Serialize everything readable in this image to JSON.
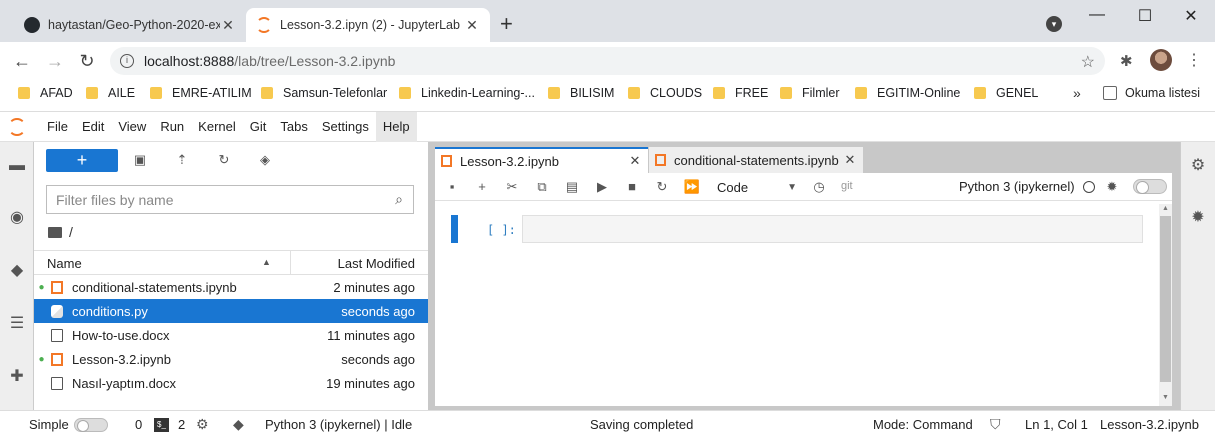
{
  "browser": {
    "tabs": [
      {
        "title": "haytastan/Geo-Python-2020-exe",
        "close": "✕"
      },
      {
        "title": "Lesson-3.2.ipyn (2) - JupyterLab",
        "close": "✕"
      }
    ],
    "new_tab": "+",
    "window_controls": {
      "minimize": "—",
      "maximize": "☐",
      "close": "✕"
    },
    "url_host": "localhost:8888",
    "url_path": "/lab/tree/Lesson-3.2.ipynb",
    "bookmarks": [
      "AFAD",
      "AILE",
      "EMRE-ATILIM",
      "Samsun-Telefonlar",
      "Linkedin-Learning-...",
      "BILISIM",
      "CLOUDS",
      "FREE",
      "Filmler",
      "EGITIM-Online",
      "GENEL"
    ],
    "bookmarks_more": "»",
    "reading_list": "Okuma listesi"
  },
  "menu": [
    "File",
    "Edit",
    "View",
    "Run",
    "Kernel",
    "Git",
    "Tabs",
    "Settings",
    "Help"
  ],
  "filebrowser": {
    "new_button": "+",
    "filter_placeholder": "Filter files by name",
    "breadcrumb": "/",
    "columns": {
      "name": "Name",
      "modified": "Last Modified"
    },
    "files": [
      {
        "name": "conditional-statements.ipynb",
        "modified": "2 minutes ago",
        "type": "notebook",
        "running": true
      },
      {
        "name": "conditions.py",
        "modified": "seconds ago",
        "type": "python",
        "running": false,
        "selected": true
      },
      {
        "name": "How-to-use.docx",
        "modified": "11 minutes ago",
        "type": "doc",
        "running": false
      },
      {
        "name": "Lesson-3.2.ipynb",
        "modified": "seconds ago",
        "type": "notebook",
        "running": true
      },
      {
        "name": "Nasıl-yaptım.docx",
        "modified": "19 minutes ago",
        "type": "doc",
        "running": false
      }
    ]
  },
  "editor": {
    "tabs": [
      {
        "label": "Lesson-3.2.ipynb",
        "close": "✕"
      },
      {
        "label": "conditional-statements.ipynb",
        "close": "✕"
      }
    ],
    "cell_type": "Code",
    "git_label": "git",
    "kernel": "Python 3 (ipykernel)",
    "prompt": "[ ]:"
  },
  "statusbar": {
    "simple_label": "Simple",
    "terminals": "0",
    "kernels": "2",
    "kernel_status": "Python 3 (ipykernel) | Idle",
    "message": "Saving completed",
    "mode": "Mode: Command",
    "position": "Ln 1, Col 1",
    "filename": "Lesson-3.2.ipynb"
  },
  "colors": {
    "accent": "#1976d2",
    "jupyter_orange": "#f37726"
  }
}
